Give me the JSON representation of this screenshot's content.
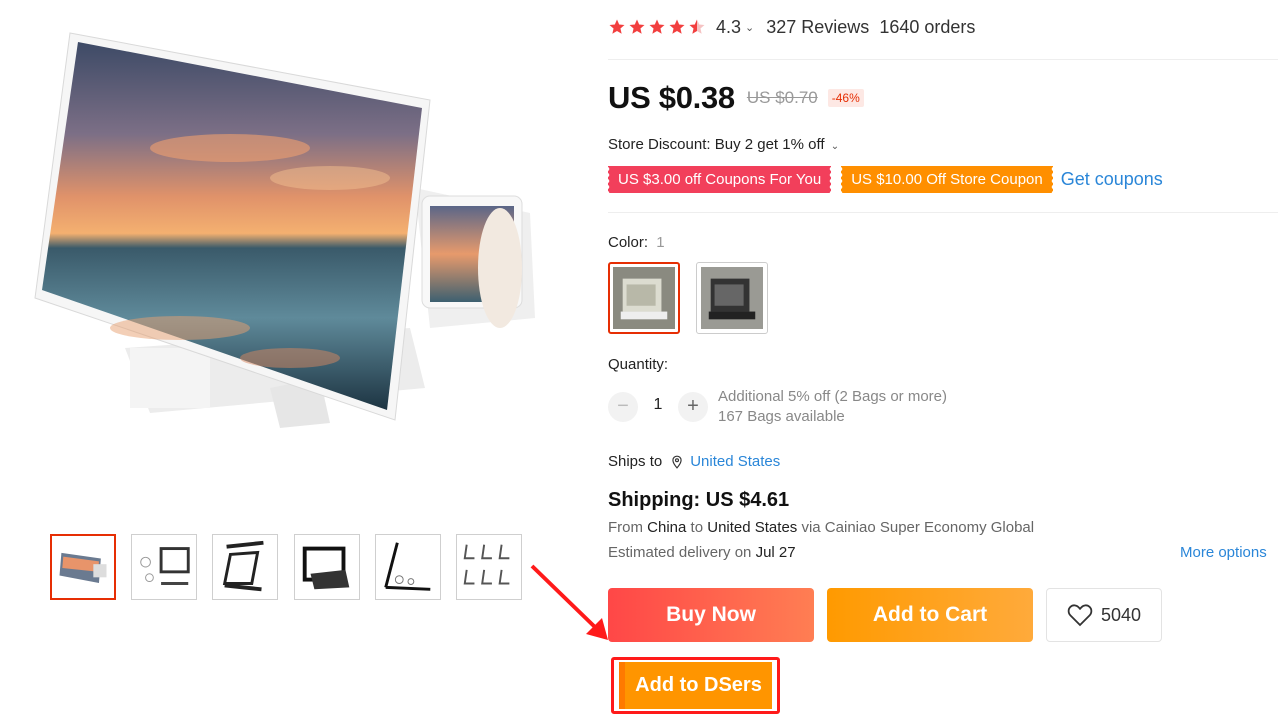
{
  "rating": {
    "value": "4.3",
    "stars": 4.5,
    "reviews": "327 Reviews",
    "orders": "1640 orders"
  },
  "price": {
    "current": "US $0.38",
    "original": "US $0.70",
    "discount": "-46%"
  },
  "store_discount": {
    "label": "Store Discount:",
    "value": "Buy 2 get 1% off"
  },
  "coupons": {
    "items": [
      "US $3.00 off Coupons For You",
      "US $10.00 Off Store Coupon"
    ],
    "get_link": "Get coupons"
  },
  "color": {
    "label": "Color:",
    "value": "1"
  },
  "quantity": {
    "label": "Quantity:",
    "value": "1",
    "minus": "−",
    "plus": "+",
    "offer": "Additional 5% off (2 Bags or more)",
    "available": "167 Bags available"
  },
  "shipping": {
    "ships_to_label": "Ships to",
    "country": "United States",
    "price": "Shipping: US $4.61",
    "route_from": "From",
    "route_origin": "China",
    "route_to": "to",
    "route_dest": "United States",
    "route_via": "via Cainiao Super Economy Global",
    "delivery_label": "Estimated delivery on",
    "delivery_date": "Jul 27",
    "more_options": "More options"
  },
  "buttons": {
    "buy_now": "Buy Now",
    "add_to_cart": "Add to Cart",
    "wishlist_count": "5040",
    "add_to_dsers": "Add to DSers"
  },
  "colors": {
    "brand_red": "#e62e04",
    "coupon_red": "#f23f5b",
    "coupon_orange": "#ff8f00",
    "link_blue": "#2a86d8",
    "star_red": "#f23f3f",
    "highlight_red": "#ff1a1a"
  },
  "icons": {
    "star": "star-icon",
    "location": "location-pin-icon",
    "heart": "heart-icon",
    "chevron": "chevron-down-icon"
  }
}
